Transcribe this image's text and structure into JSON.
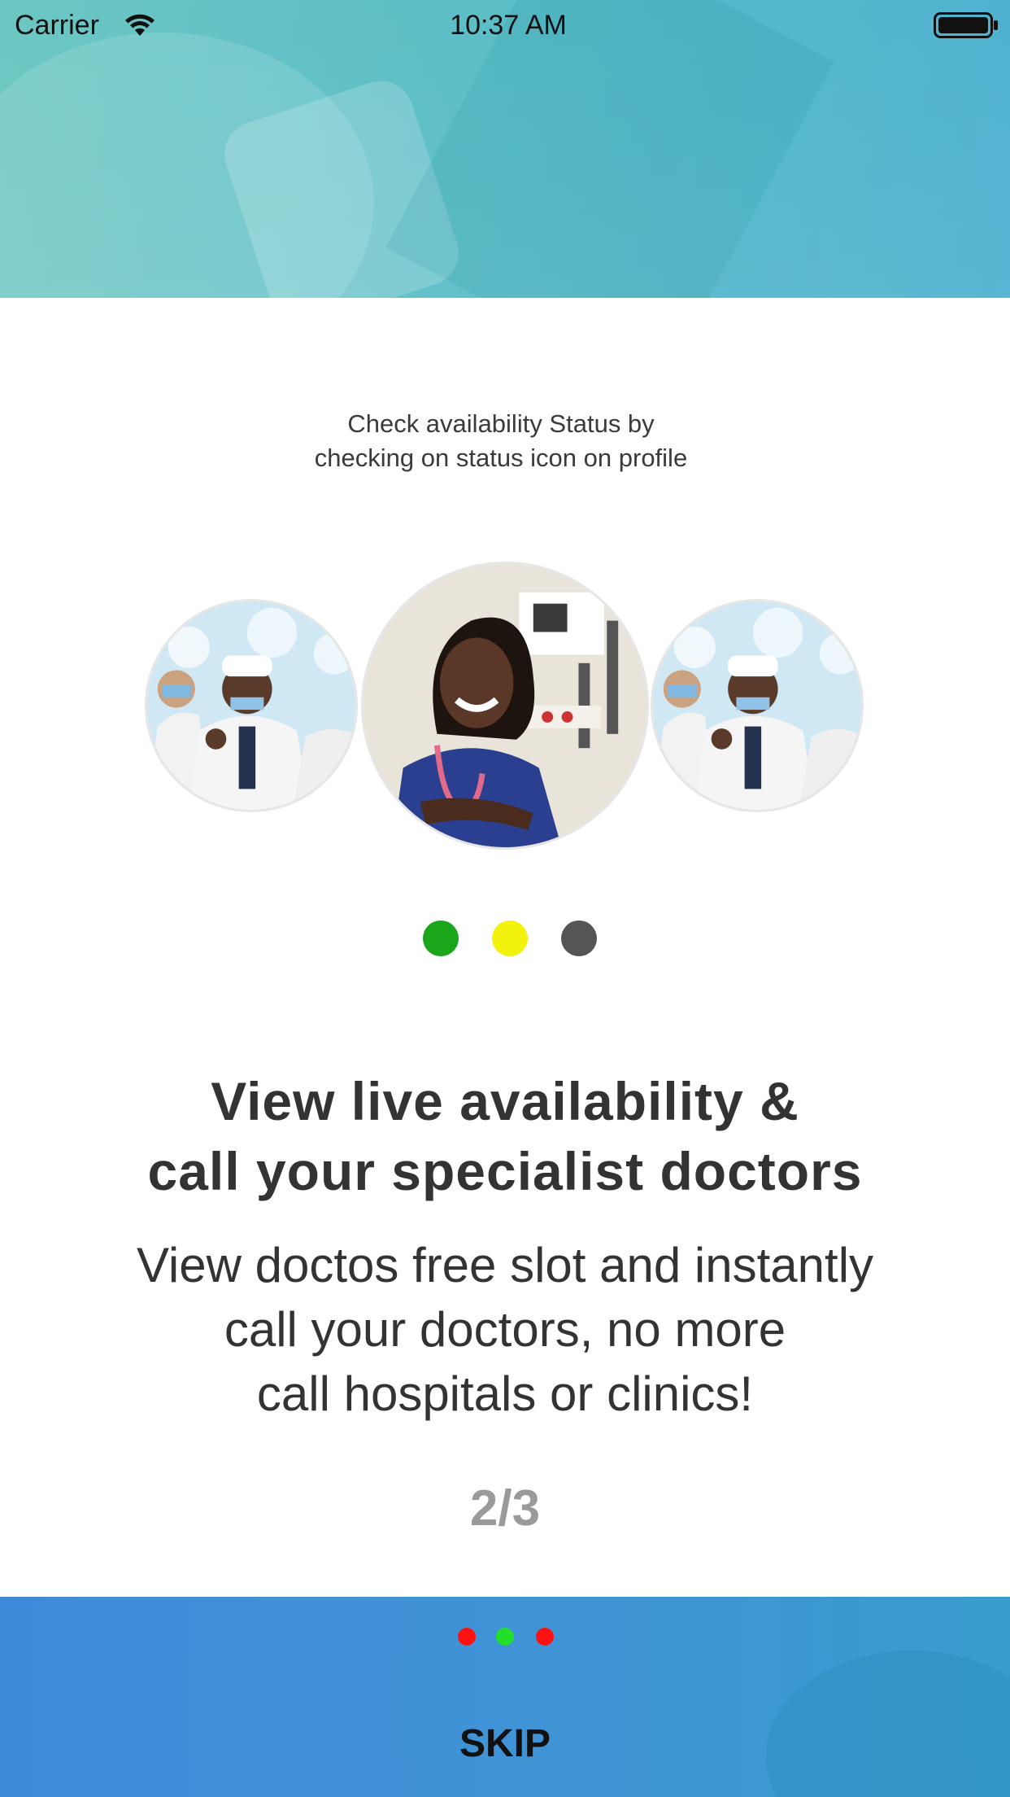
{
  "status_bar": {
    "carrier": "Carrier",
    "time": "10:37 AM",
    "wifi_icon": "wifi-icon",
    "battery_icon": "battery-icon"
  },
  "caption": {
    "line1": "Check availability Status by",
    "line2": "checking on status icon on profile"
  },
  "doctors": {
    "left_image": "doctor-group-photo",
    "center_image": "nurse-photo",
    "right_image": "doctor-group-photo"
  },
  "status_legend": {
    "colors": [
      "#1aa51a",
      "#f2f20c",
      "#555555"
    ]
  },
  "headline": {
    "line1": "View live availability &",
    "line2": "call your specialist doctors"
  },
  "body": {
    "line1": "View doctos free slot and instantly",
    "line2": "call your doctors, no more",
    "line3": "call hospitals or clinics!"
  },
  "page_counter": "2/3",
  "footer": {
    "page_indicator": {
      "total": 3,
      "current": 2,
      "active_color": "#22e02a",
      "inactive_color": "#ff1111"
    },
    "skip_label": "SKIP"
  }
}
